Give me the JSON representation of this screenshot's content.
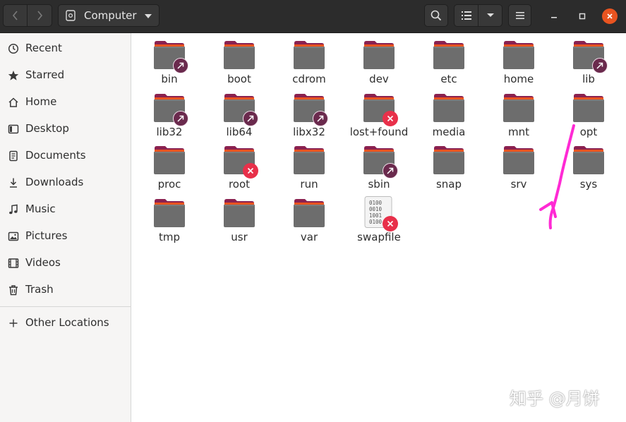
{
  "headerbar": {
    "location_label": "Computer",
    "back_icon": "chevron-left-icon",
    "forward_icon": "chevron-right-icon",
    "search_icon": "search-icon",
    "view_icon": "list-view-icon",
    "menu_icon": "hamburger-menu-icon",
    "close_color": "#e95420"
  },
  "sidebar": {
    "items": [
      {
        "label": "Recent",
        "icon": "clock-icon"
      },
      {
        "label": "Starred",
        "icon": "star-icon"
      },
      {
        "label": "Home",
        "icon": "home-icon"
      },
      {
        "label": "Desktop",
        "icon": "desktop-icon"
      },
      {
        "label": "Documents",
        "icon": "documents-icon"
      },
      {
        "label": "Downloads",
        "icon": "download-icon"
      },
      {
        "label": "Music",
        "icon": "music-icon"
      },
      {
        "label": "Pictures",
        "icon": "pictures-icon"
      },
      {
        "label": "Videos",
        "icon": "videos-icon"
      },
      {
        "label": "Trash",
        "icon": "trash-icon"
      }
    ],
    "other_locations": {
      "label": "Other Locations",
      "icon": "plus-icon"
    }
  },
  "files": [
    {
      "name": "bin",
      "emblem": "symlink"
    },
    {
      "name": "boot",
      "emblem": "none"
    },
    {
      "name": "cdrom",
      "emblem": "none"
    },
    {
      "name": "dev",
      "emblem": "none"
    },
    {
      "name": "etc",
      "emblem": "none"
    },
    {
      "name": "home",
      "emblem": "none"
    },
    {
      "name": "lib",
      "emblem": "symlink"
    },
    {
      "name": "lib32",
      "emblem": "symlink"
    },
    {
      "name": "lib64",
      "emblem": "symlink"
    },
    {
      "name": "libx32",
      "emblem": "symlink"
    },
    {
      "name": "lost+found",
      "emblem": "no-access"
    },
    {
      "name": "media",
      "emblem": "none"
    },
    {
      "name": "mnt",
      "emblem": "none"
    },
    {
      "name": "opt",
      "emblem": "none"
    },
    {
      "name": "proc",
      "emblem": "none"
    },
    {
      "name": "root",
      "emblem": "no-access"
    },
    {
      "name": "run",
      "emblem": "none"
    },
    {
      "name": "sbin",
      "emblem": "symlink"
    },
    {
      "name": "snap",
      "emblem": "none"
    },
    {
      "name": "srv",
      "emblem": "none"
    },
    {
      "name": "sys",
      "emblem": "none"
    },
    {
      "name": "tmp",
      "emblem": "none"
    },
    {
      "name": "usr",
      "emblem": "none"
    },
    {
      "name": "var",
      "emblem": "none"
    },
    {
      "name": "swapfile",
      "emblem": "no-access",
      "type": "binary-file"
    }
  ],
  "annotation_color": "#ff2ad4",
  "watermark": "知乎 @月饼"
}
